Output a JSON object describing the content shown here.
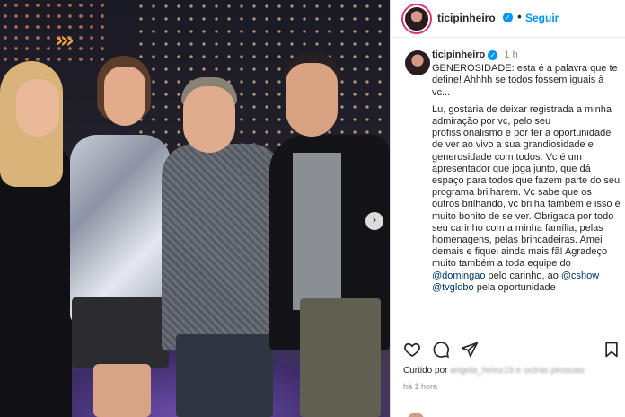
{
  "post": {
    "username": "ticipinheiro",
    "follow_label": "Seguir",
    "separator": "•"
  },
  "caption": {
    "username": "ticipinheiro",
    "time": "1 h",
    "p1": "GENEROSIDADE: esta é a palavra que te define! Ahhhh se todos fossem iguais à vc...",
    "p2": "Lu, gostaria de deixar registrada a minha admiração por vc, pelo seu profissionalismo e por ter a oportunidade de ver ao vivo a sua grandiosidade e generosidade com todos. Vc é um apresentador que joga junto, que dá espaço para todos que fazem parte do seu programa brilharem. Vc sabe que os outros brilhando, vc brilha também e isso é muito bonito de se ver. Obrigada por todo seu carinho com a minha família, pelas homenagens, pelas brincadeiras. Amei demais e fiquei ainda mais fã! Agradeço muito também a toda equipe do",
    "mention1": "@domingao",
    "p3": "pelo carinho, ao",
    "mention2": "@cshow",
    "mention3": "@tvglobo",
    "p4": "pela oportunidade"
  },
  "likes": {
    "prefix": "Curtido por",
    "names": "angela_heinz19 e outras pessoas"
  },
  "timestamp": "há 1 hora",
  "photo": {
    "chevrons": "›››",
    "next_arrow": "›"
  },
  "icons": {
    "like": "heart-icon",
    "comment": "comment-icon",
    "share": "share-icon",
    "save": "bookmark-icon",
    "verified": "verified-badge-icon"
  },
  "colors": {
    "link": "#0095f6",
    "mention": "#00376b",
    "muted": "#8e8e8e"
  }
}
